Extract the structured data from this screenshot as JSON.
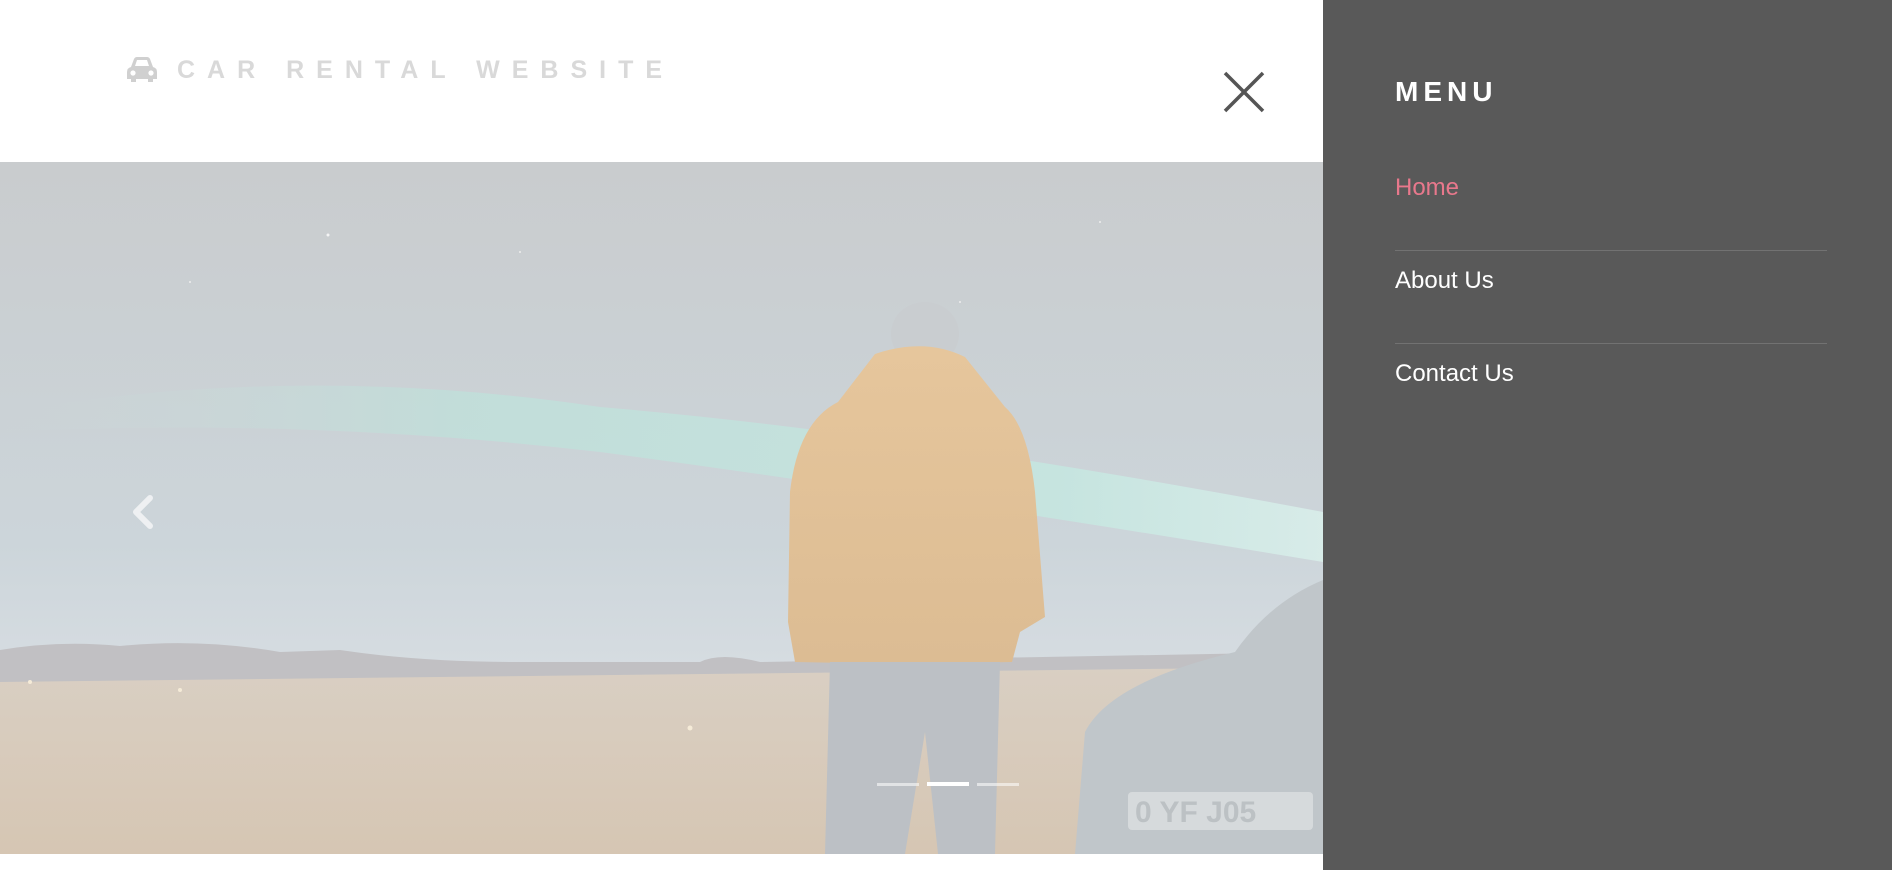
{
  "header": {
    "brand_icon": "car-icon",
    "brand_text": "CAR RENTAL WEBSITE",
    "close_icon": "close-icon"
  },
  "hero": {
    "prev_icon": "chevron-left-icon",
    "slide_count": 3,
    "active_slide": 2,
    "plate_text": "0 YF  J05"
  },
  "menu": {
    "title": "MENU",
    "items": [
      {
        "label": "Home",
        "active": true
      },
      {
        "label": "About Us",
        "active": false
      },
      {
        "label": "Contact Us",
        "active": false
      }
    ]
  },
  "colors": {
    "menu_bg": "#595959",
    "active_link": "#e8788c",
    "brand_text": "#d9d9d9"
  }
}
